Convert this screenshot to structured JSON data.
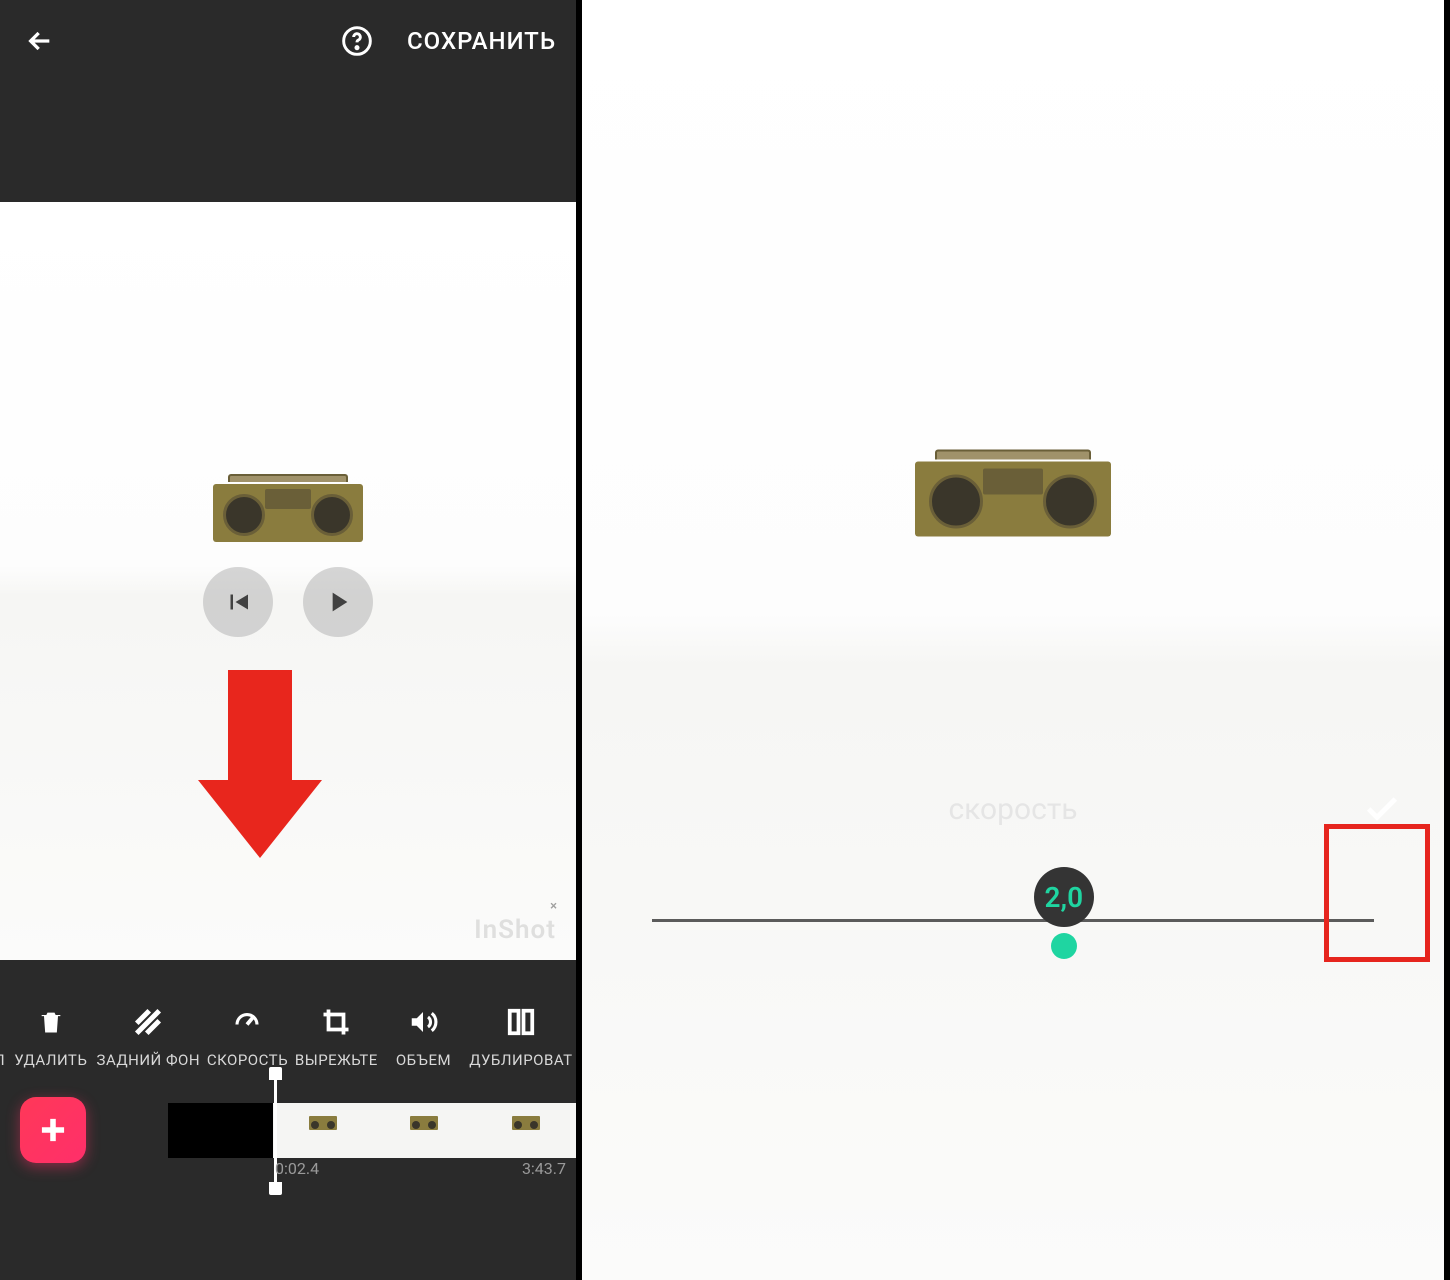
{
  "left": {
    "header": {
      "save_label": "СОХРАНИТЬ"
    },
    "watermark": "InShot",
    "toolbar": [
      {
        "label": "ОЛ",
        "icon": "crop-partial"
      },
      {
        "label": "УДАЛИТЬ",
        "icon": "trash"
      },
      {
        "label": "ЗАДНИЙ ФОН",
        "icon": "stripes"
      },
      {
        "label": "СКОРОСТЬ",
        "icon": "speed"
      },
      {
        "label": "ВЫРЕЖЬТЕ",
        "icon": "crop"
      },
      {
        "label": "ОБЪЕМ",
        "icon": "volume"
      },
      {
        "label": "ДУБЛИРОВАТ",
        "icon": "duplicate"
      }
    ],
    "timeline": {
      "current_time": "0:02.4",
      "total_time": "3:43.7"
    }
  },
  "right": {
    "speed_title": "скорость",
    "speed_value": "2,0",
    "slider_position_percent": 56.5
  }
}
